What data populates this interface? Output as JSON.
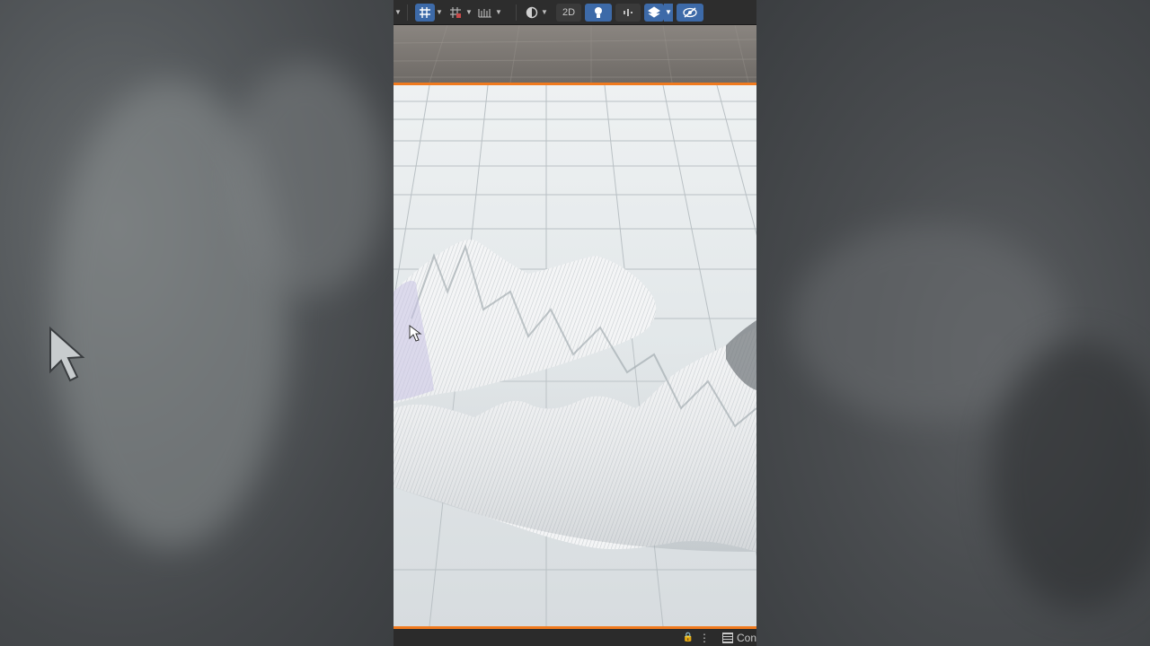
{
  "toolbar": {
    "view_mode_2d": "2D",
    "active_color": "#3d6aa8"
  },
  "statusbar": {
    "lock_icon": "🔒",
    "more_icon": "⋮",
    "console_label": "Con"
  },
  "colors": {
    "accent_orange": "#f07a1e",
    "editor_dark": "#2d2d2d"
  },
  "icons": [
    "grid-snap-icon",
    "grid-icon",
    "ruler-icon",
    "shading-icon",
    "light-icon",
    "audio-icon",
    "layers-icon",
    "visibility-icon",
    "lock-icon",
    "console-icon"
  ]
}
